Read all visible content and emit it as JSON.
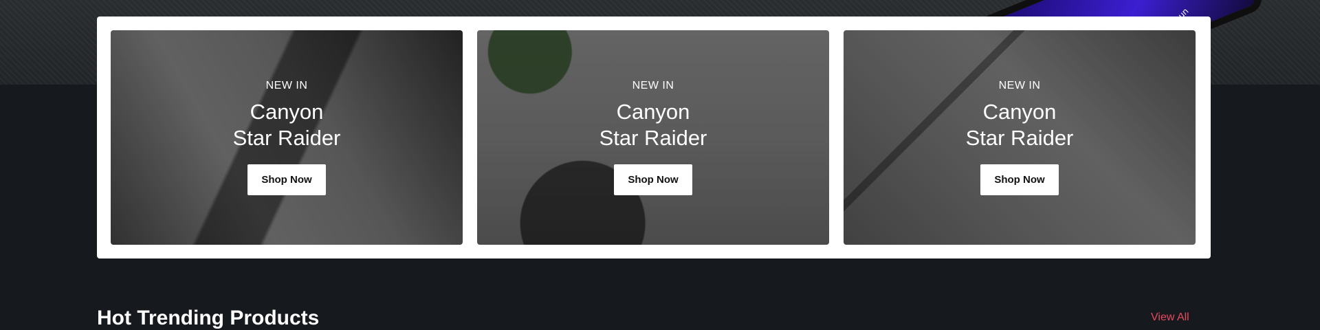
{
  "hero": {
    "device_text": "to un"
  },
  "banners": [
    {
      "eyebrow": "NEW IN",
      "title_line1": "Canyon",
      "title_line2": "Star Raider",
      "button": "Shop Now"
    },
    {
      "eyebrow": "NEW IN",
      "title_line1": "Canyon",
      "title_line2": "Star Raider",
      "button": "Shop Now"
    },
    {
      "eyebrow": "NEW IN",
      "title_line1": "Canyon",
      "title_line2": "Star Raider",
      "button": "Shop Now"
    }
  ],
  "section": {
    "title": "Hot Trending Products",
    "view_all": "View All"
  },
  "colors": {
    "background": "#16191e",
    "accent": "#e84a5f",
    "card_bg": "#ffffff"
  }
}
